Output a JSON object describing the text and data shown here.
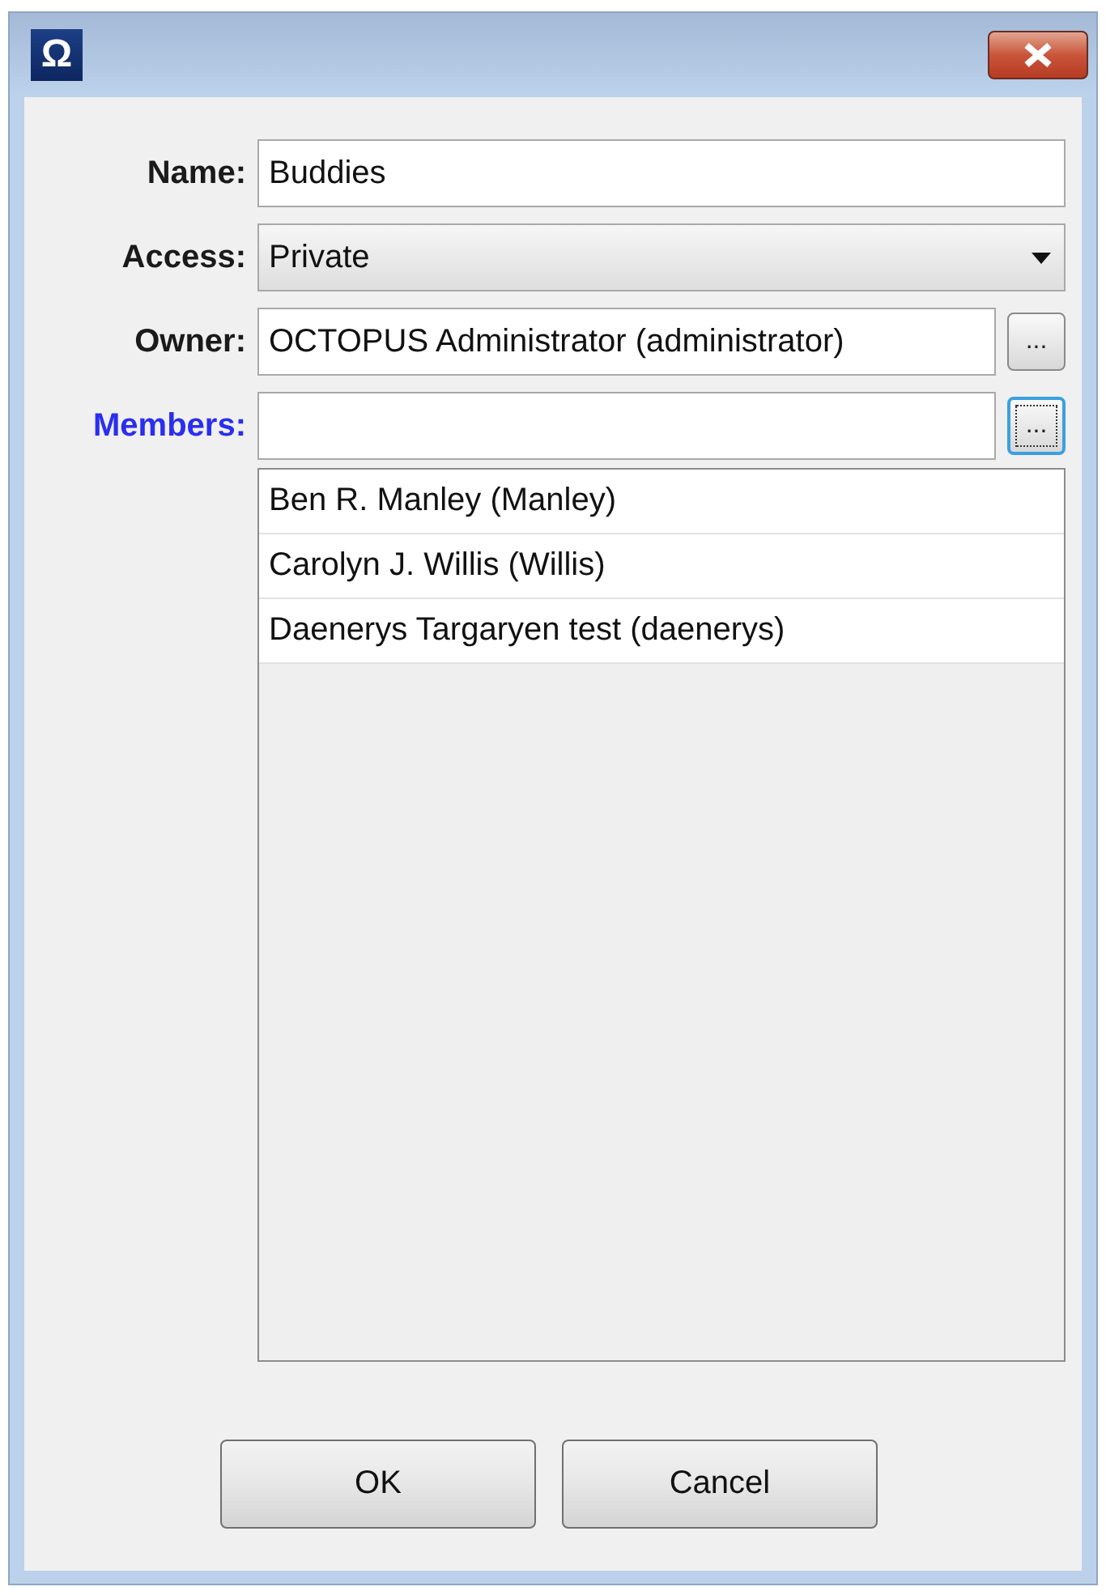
{
  "window": {
    "app_icon": "Ω"
  },
  "fields": [
    {
      "kind": "text",
      "label": "Name:",
      "label_highlighted": false,
      "value": "Buddies"
    },
    {
      "kind": "select",
      "label": "Access:",
      "label_highlighted": false,
      "value": "Private"
    },
    {
      "kind": "picker",
      "label": "Owner:",
      "label_highlighted": false,
      "value": "OCTOPUS Administrator (administrator)",
      "button": "...",
      "button_focused": false
    },
    {
      "kind": "picker",
      "label": "Members:",
      "label_highlighted": true,
      "button": "...",
      "button_focused": true
    }
  ],
  "members": [
    "Ben R. Manley (Manley)",
    "Carolyn J. Willis (Willis)",
    "Daenerys Targaryen test (daenerys)"
  ],
  "buttons": [
    "OK",
    "Cancel"
  ]
}
